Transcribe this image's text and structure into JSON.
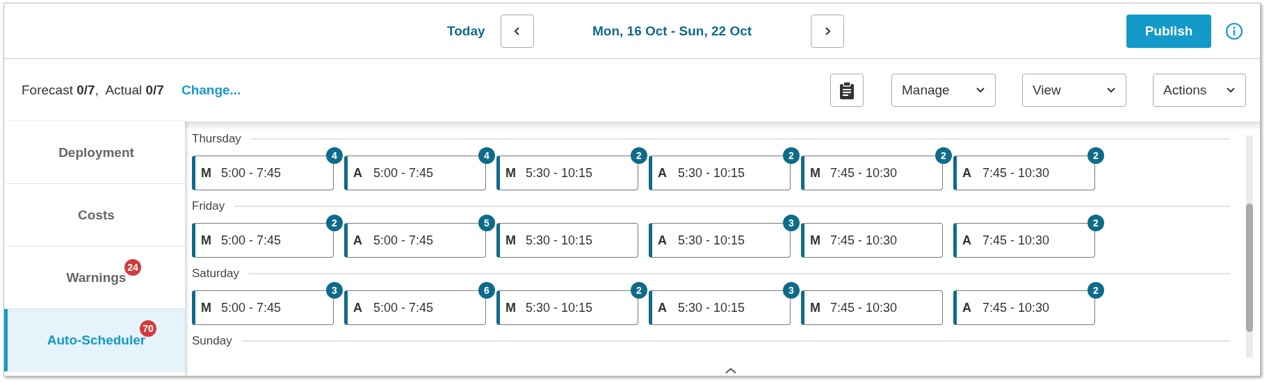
{
  "toolbar": {
    "today": "Today",
    "date_range": "Mon, 16 Oct - Sun, 22 Oct",
    "publish": "Publish"
  },
  "summary": {
    "text": "Forecast **0/7**,  Actual **0/7**",
    "change_link": "Change..."
  },
  "menus": [
    {
      "label": "Manage"
    },
    {
      "label": "View"
    },
    {
      "label": "Actions"
    }
  ],
  "sidebar": {
    "items": [
      {
        "label": "Deployment",
        "selected": false
      },
      {
        "label": "Costs",
        "selected": false
      },
      {
        "label": "Warnings",
        "badge": "24",
        "selected": false
      },
      {
        "label": "Auto-Scheduler",
        "badge": "70",
        "selected": true
      }
    ]
  },
  "days": [
    {
      "name": "Thursday",
      "shifts": [
        {
          "code": "M",
          "time": "5:00 - 7:45",
          "count": "4"
        },
        {
          "code": "A",
          "time": "5:00 - 7:45",
          "count": "4"
        },
        {
          "code": "M",
          "time": "5:30 - 10:15",
          "count": "2"
        },
        {
          "code": "A",
          "time": "5:30 - 10:15",
          "count": "2"
        },
        {
          "code": "M",
          "time": "7:45 - 10:30",
          "count": "2"
        },
        {
          "code": "A",
          "time": "7:45 - 10:30",
          "count": "2"
        }
      ]
    },
    {
      "name": "Friday",
      "shifts": [
        {
          "code": "M",
          "time": "5:00 - 7:45",
          "count": "2"
        },
        {
          "code": "A",
          "time": "5:00 - 7:45",
          "count": "5"
        },
        {
          "code": "M",
          "time": "5:30 - 10:15"
        },
        {
          "code": "A",
          "time": "5:30 - 10:15",
          "count": "3"
        },
        {
          "code": "M",
          "time": "7:45 - 10:30"
        },
        {
          "code": "A",
          "time": "7:45 - 10:30",
          "count": "2"
        }
      ]
    },
    {
      "name": "Saturday",
      "shifts": [
        {
          "code": "M",
          "time": "5:00 - 7:45",
          "count": "3"
        },
        {
          "code": "A",
          "time": "5:00 - 7:45",
          "count": "6"
        },
        {
          "code": "M",
          "time": "5:30 - 10:15",
          "count": "2"
        },
        {
          "code": "A",
          "time": "5:30 - 10:15",
          "count": "3"
        },
        {
          "code": "M",
          "time": "7:45 - 10:30"
        },
        {
          "code": "A",
          "time": "7:45 - 10:30",
          "count": "2"
        }
      ]
    },
    {
      "name": "Sunday"
    }
  ]
}
